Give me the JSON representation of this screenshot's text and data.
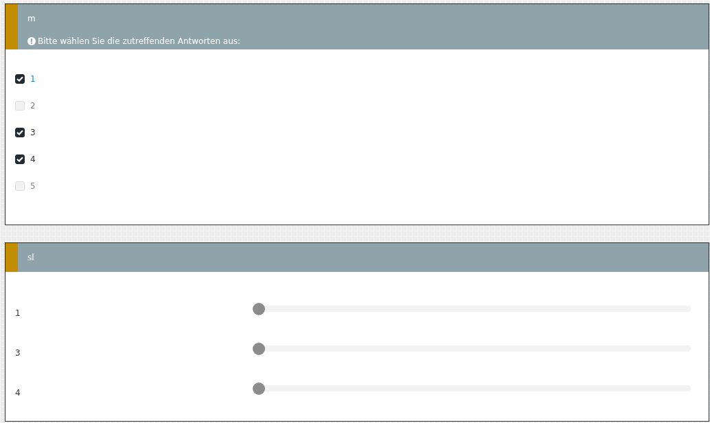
{
  "panels": [
    {
      "title": "m",
      "hint": "Bitte wählen Sie die zutreffenden Antworten aus:",
      "kind": "checkboxes",
      "options": [
        {
          "label": "1",
          "checked": true,
          "focused": true
        },
        {
          "label": "2",
          "checked": false,
          "focused": false
        },
        {
          "label": "3",
          "checked": true,
          "focused": false
        },
        {
          "label": "4",
          "checked": true,
          "focused": false
        },
        {
          "label": "5",
          "checked": false,
          "focused": false
        }
      ]
    },
    {
      "title": "sl",
      "kind": "sliders",
      "sliders": [
        {
          "label": "1",
          "level": 0
        },
        {
          "label": "3",
          "level": 0
        },
        {
          "label": "4",
          "level": 0
        }
      ]
    }
  ]
}
